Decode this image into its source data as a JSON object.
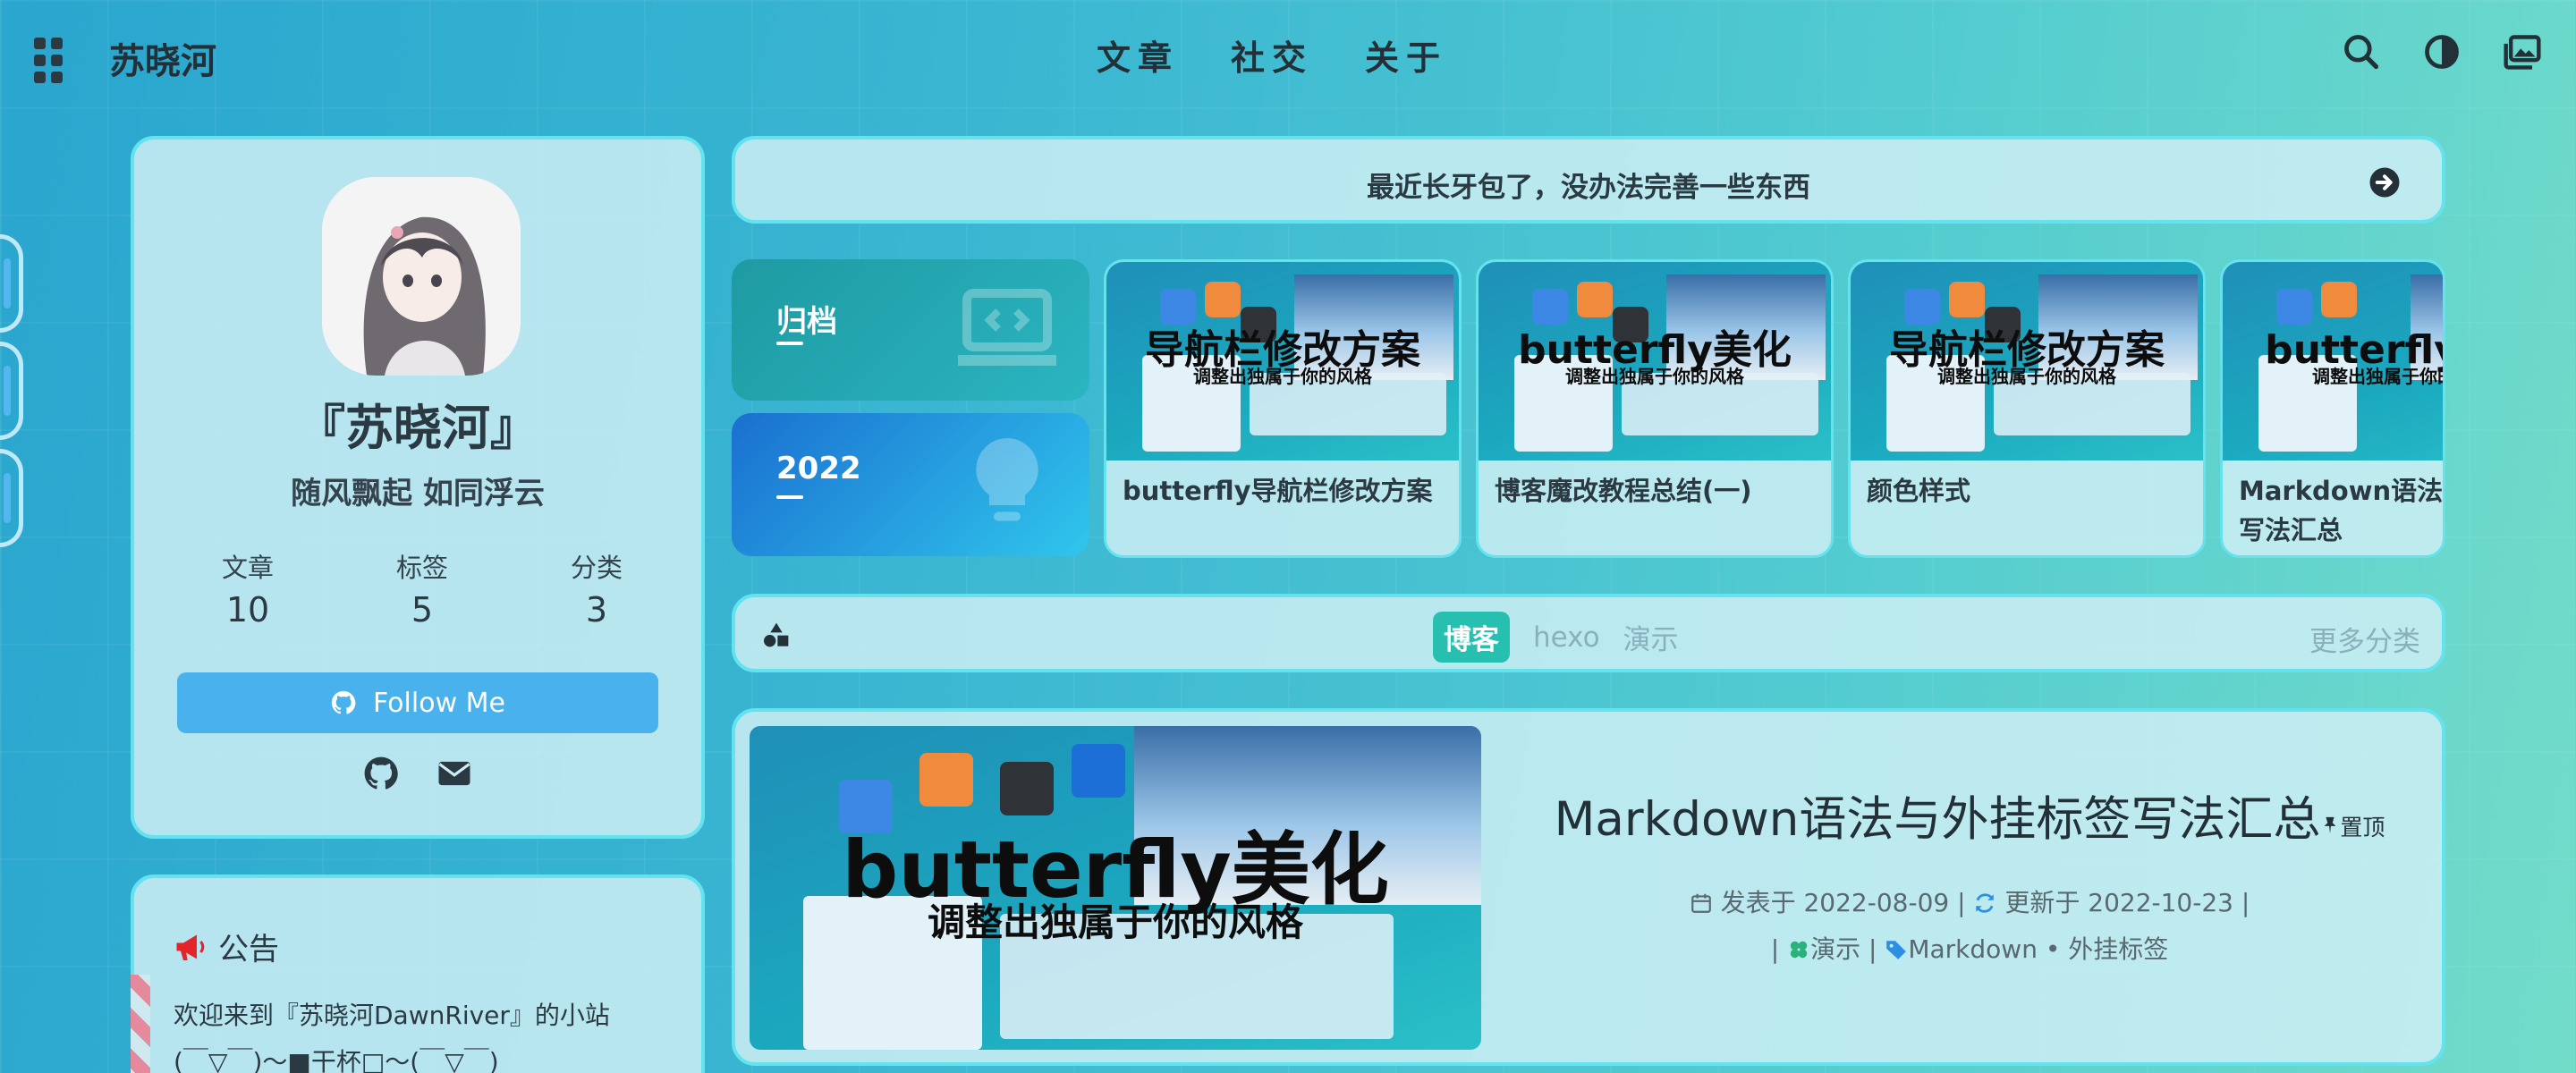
{
  "site": {
    "brand": "苏晓河"
  },
  "nav": {
    "menu": [
      "文章",
      "社交",
      "关于"
    ]
  },
  "profile": {
    "name": "『苏晓河』",
    "description": "随风飘起 如同浮云",
    "stats": [
      {
        "label": "文章",
        "value": "10"
      },
      {
        "label": "标签",
        "value": "5"
      },
      {
        "label": "分类",
        "value": "3"
      }
    ],
    "follow_label": "Follow Me"
  },
  "notice": {
    "title": "公告",
    "lines": [
      "欢迎来到『苏晓河DawnRiver』的小站",
      "(￣▽￣)～■干杯□～(￣▽￣)"
    ]
  },
  "bulletin": {
    "text": "最近长牙包了，没办法完善一些东西"
  },
  "tiles": {
    "archive_label": "归档",
    "year_label": "2022"
  },
  "recent_posts": [
    {
      "title": "butterfly导航栏修改方案",
      "cover_title": "导航栏修改方案",
      "cover_subtitle": "调整出独属于你的风格"
    },
    {
      "title": "博客魔改教程总结(一)",
      "cover_title": "butterfly美化",
      "cover_subtitle": "调整出独属于你的风格"
    },
    {
      "title": "颜色样式",
      "cover_title": "导航栏修改方案",
      "cover_subtitle": "调整出独属于你的风格"
    },
    {
      "title": "Markdown语法与外挂标签写法汇总",
      "cover_title": "butterfly美化",
      "cover_subtitle": "调整出独属于你的风格"
    }
  ],
  "categories": {
    "tabs": [
      {
        "label": "博客",
        "active": true
      },
      {
        "label": "hexo",
        "active": false
      },
      {
        "label": "演示",
        "active": false
      }
    ],
    "more_label": "更多分类"
  },
  "featured_post": {
    "title": "Markdown语法与外挂标签写法汇总",
    "pinned_label": "置顶",
    "published": "发表于 2022-08-09",
    "updated": "更新于 2022-10-23",
    "category": "演示",
    "tags": "Markdown • 外挂标签",
    "sep": "|",
    "cover_title": "butterfly美化",
    "cover_subtitle": "调整出独属于你的风格"
  },
  "colors": {
    "accent": "#49b1ec",
    "card_border": "#64e3ee",
    "active_tab": "#27c0b0"
  }
}
